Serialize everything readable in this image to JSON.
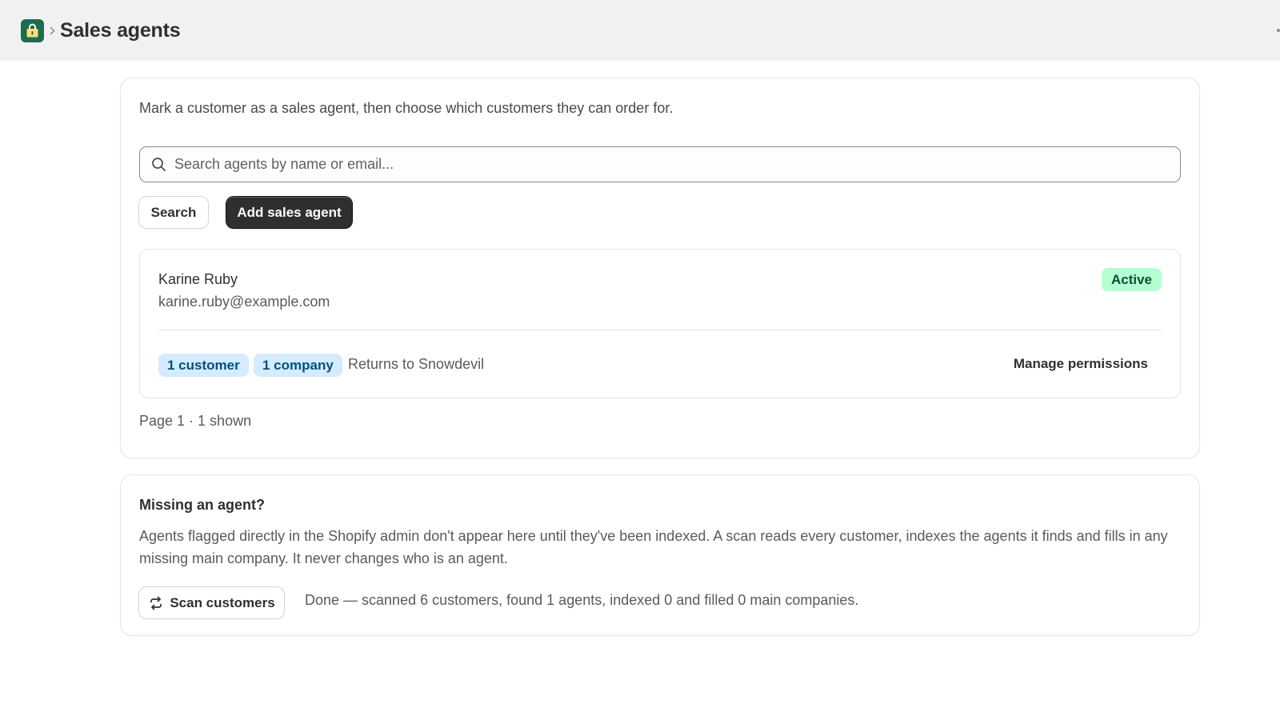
{
  "header": {
    "title": "Sales agents",
    "app_icon": "lock-bag-icon",
    "breadcrumb_separator_icon": "chevron-right-icon"
  },
  "agents_card": {
    "intro": "Mark a customer as a sales agent, then choose which customers they can order for.",
    "search": {
      "placeholder": "Search agents by name or email...",
      "value": ""
    },
    "search_button": "Search",
    "add_button": "Add sales agent",
    "agents": [
      {
        "name": "Karine Ruby",
        "email": "karine.ruby@example.com",
        "status": "Active",
        "customers_tag": "1 customer",
        "companies_tag": "1 company",
        "returns_to": "Returns to Snowdevil",
        "manage_label": "Manage permissions"
      }
    ],
    "pagination": "Page 1 · 1 shown"
  },
  "missing_card": {
    "title": "Missing an agent?",
    "body": "Agents flagged directly in the Shopify admin don't appear here until they've been indexed. A scan reads every customer, indexes the agents it finds and fills in any missing main company. It never changes who is an agent.",
    "scan_button": "Scan customers",
    "scan_status": "Done — scanned 6 customers, found 1 agents, indexed 0 and filled 0 main companies."
  },
  "colors": {
    "topbar_bg": "#f1f1f1",
    "app_icon_bg": "#1f6b52",
    "primary_button": "#2f2f2f",
    "active_badge_bg": "#b4fed2",
    "active_badge_text": "#0c5132",
    "tag_bg": "#d5ebff",
    "tag_text": "#00527c"
  }
}
